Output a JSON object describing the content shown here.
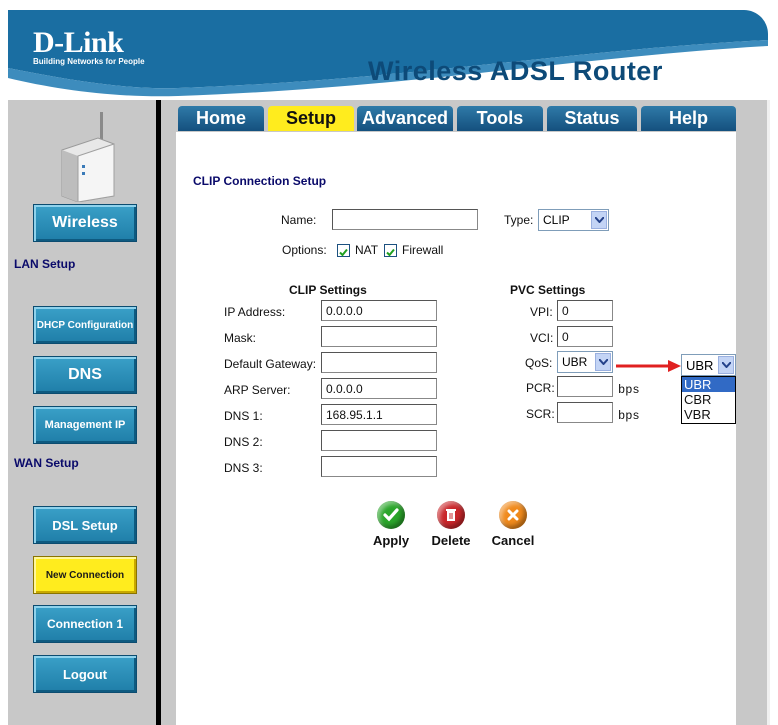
{
  "brand": {
    "logo": "D-Link",
    "tagline": "Building Networks for People",
    "product_title": "Wireless ADSL Router"
  },
  "tabs": [
    {
      "label": "Home"
    },
    {
      "label": "Setup"
    },
    {
      "label": "Advanced"
    },
    {
      "label": "Tools"
    },
    {
      "label": "Status"
    },
    {
      "label": "Help"
    }
  ],
  "sidebar": {
    "wireless": "Wireless",
    "lan_setup": "LAN Setup",
    "dhcp": "DHCP Configuration",
    "dns": "DNS",
    "mgmt_ip": "Management IP",
    "wan_setup": "WAN Setup",
    "dsl_setup": "DSL Setup",
    "new_connection": "New Connection",
    "connection1": "Connection 1",
    "logout": "Logout"
  },
  "page": {
    "title": "CLIP Connection Setup",
    "name_label": "Name:",
    "name_value": "",
    "type_label": "Type:",
    "type_value": "CLIP",
    "options_label": "Options:",
    "nat_label": "NAT",
    "firewall_label": "Firewall",
    "nat_checked": true,
    "firewall_checked": true
  },
  "clip": {
    "heading": "CLIP Settings",
    "ip_label": "IP Address:",
    "ip_value": "0.0.0.0",
    "mask_label": "Mask:",
    "mask_value": "",
    "gw_label": "Default Gateway:",
    "gw_value": "",
    "arp_label": "ARP Server:",
    "arp_value": "0.0.0.0",
    "dns1_label": "DNS 1:",
    "dns1_value": "168.95.1.1",
    "dns2_label": "DNS 2:",
    "dns2_value": "",
    "dns3_label": "DNS 3:",
    "dns3_value": ""
  },
  "pvc": {
    "heading": "PVC Settings",
    "vpi_label": "VPI:",
    "vpi_value": "0",
    "vci_label": "VCI:",
    "vci_value": "0",
    "qos_label": "QoS:",
    "qos_value": "UBR",
    "pcr_label": "PCR:",
    "pcr_value": "",
    "pcr_unit": "bps",
    "scr_label": "SCR:",
    "scr_value": "",
    "scr_unit": "bps"
  },
  "qos_dropdown": {
    "selected": "UBR",
    "options": [
      "UBR",
      "CBR",
      "VBR"
    ]
  },
  "actions": {
    "apply": "Apply",
    "delete": "Delete",
    "cancel": "Cancel"
  },
  "colors": {
    "accent": "#ffec1e",
    "nav_blue": "#1f7ea8",
    "arrow_red": "#e02020"
  }
}
